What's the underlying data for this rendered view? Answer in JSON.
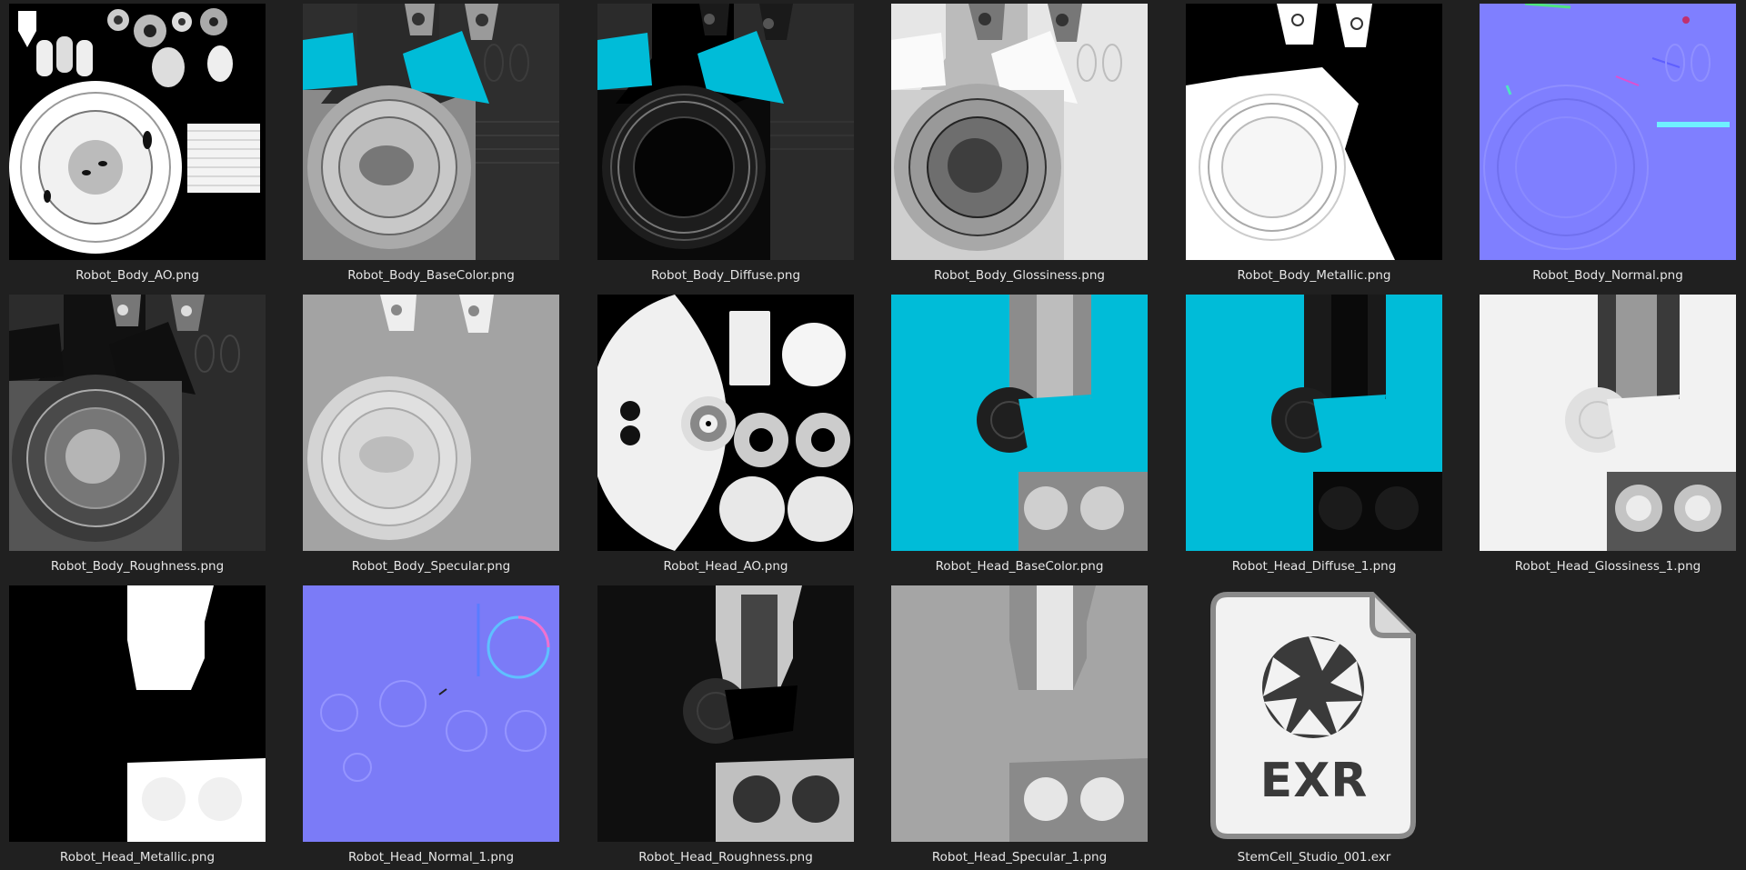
{
  "files": [
    {
      "name": "Robot_Body_AO.png"
    },
    {
      "name": "Robot_Body_BaseColor.png"
    },
    {
      "name": "Robot_Body_Diffuse.png"
    },
    {
      "name": "Robot_Body_Glossiness.png"
    },
    {
      "name": "Robot_Body_Metallic.png"
    },
    {
      "name": "Robot_Body_Normal.png"
    },
    {
      "name": "Robot_Body_Roughness.png"
    },
    {
      "name": "Robot_Body_Specular.png"
    },
    {
      "name": "Robot_Head_AO.png"
    },
    {
      "name": "Robot_Head_BaseColor.png"
    },
    {
      "name": "Robot_Head_Diffuse_1.png"
    },
    {
      "name": "Robot_Head_Glossiness_1.png"
    },
    {
      "name": "Robot_Head_Metallic.png"
    },
    {
      "name": "Robot_Head_Normal_1.png"
    },
    {
      "name": "Robot_Head_Roughness.png"
    },
    {
      "name": "Robot_Head_Specular_1.png"
    },
    {
      "name": "StemCell_Studio_001.exr",
      "icon": "aperture-icon",
      "badge": "EXR"
    }
  ],
  "colors": {
    "background": "#202020",
    "cyan": "#00bcd8",
    "normal_blue": "#7f7fff"
  }
}
